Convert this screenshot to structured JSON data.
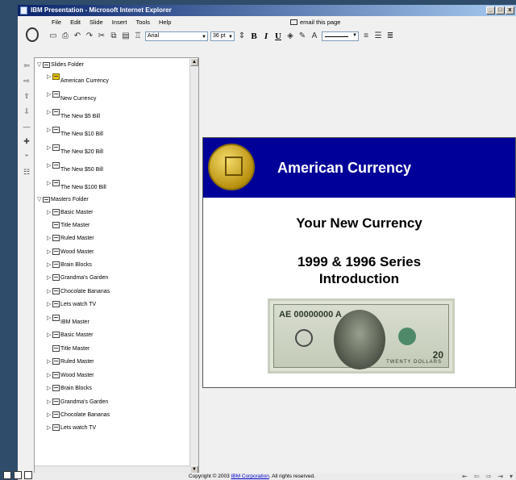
{
  "window": {
    "title": "IBM Presentation - Microsoft Internet Explorer",
    "controls": [
      "_",
      "□",
      "x"
    ]
  },
  "menu": {
    "items": [
      "File",
      "Edit",
      "Slide",
      "Insert",
      "Tools",
      "Help"
    ]
  },
  "email": {
    "label": "email this page"
  },
  "toolbar": {
    "font_family": "Arial",
    "font_size": "36 pt",
    "bold": "B",
    "italic": "I",
    "underline": "U"
  },
  "tree": {
    "slides_folder": "Slides Folder",
    "slides": [
      "American Currency",
      "New Currency",
      "The New $5 Bill",
      "The New $10 Bill",
      "The New $20 Bill",
      "The New $50 Bill",
      "The New $100 Bill"
    ],
    "masters_folder": "Masters Folder",
    "masters_group1": [
      "Basic Master",
      "Title Master",
      "Ruled Master",
      "Wood Master",
      "Brain Blocks",
      "Grandma's Garden",
      "Chocolate Bananas",
      "Lets watch TV"
    ],
    "ibm_master": "IBM Master",
    "masters_group2": [
      "Basic Master",
      "Title Master",
      "Ruled Master",
      "Wood Master",
      "Brain Blocks",
      "Grandma's Garden",
      "Chocolate Bananas",
      "Lets watch TV"
    ]
  },
  "slide": {
    "title": "American Currency",
    "subtitle1": "Your New Currency",
    "subtitle2_line1": "1999 & 1996 Series",
    "subtitle2_line2": "Introduction",
    "bill_serial": "AE 00000000 A",
    "bill_band": "TWENTY DOLLARS",
    "bill_value": "20",
    "header_color": "#000099"
  },
  "status": {
    "copyright_prefix": "Copyright © 2003 ",
    "copyright_link": "IBM Corporation",
    "copyright_suffix": ". All rights reserved."
  }
}
